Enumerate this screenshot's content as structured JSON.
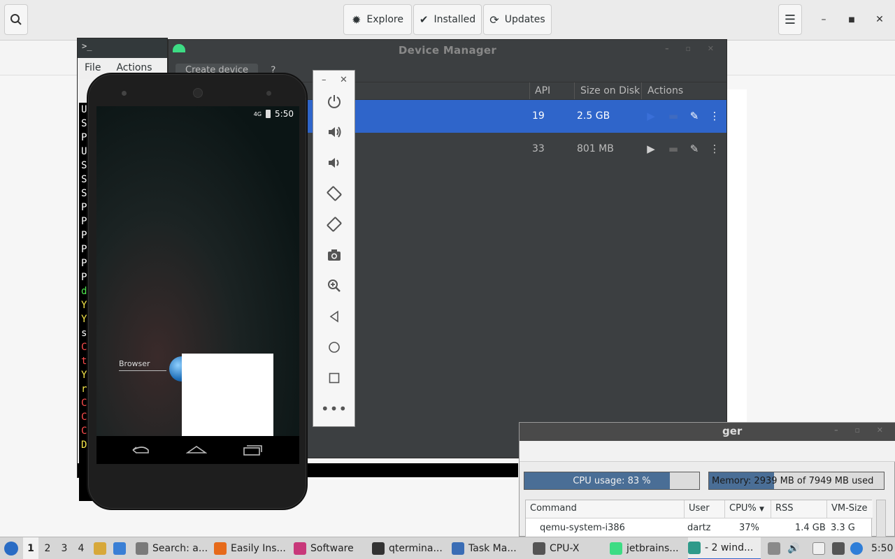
{
  "software": {
    "tabs": [
      {
        "label": "Explore",
        "icon": "compass-icon"
      },
      {
        "label": "Installed",
        "icon": "check-circle-icon"
      },
      {
        "label": "Updates",
        "icon": "refresh-icon"
      }
    ]
  },
  "qterminal": {
    "menu": [
      "File",
      "Actions"
    ],
    "lines": [
      {
        "t": "U",
        "c": "#ffffff"
      },
      {
        "t": "S",
        "c": "#ffffff"
      },
      {
        "t": "P",
        "c": "#ffffff"
      },
      {
        "t": "U",
        "c": "#ffffff"
      },
      {
        "t": "S",
        "c": "#ffffff"
      },
      {
        "t": "S",
        "c": "#ffffff"
      },
      {
        "t": "S",
        "c": "#ffffff"
      },
      {
        "t": "P",
        "c": "#ffffff"
      },
      {
        "t": "P",
        "c": "#ffffff"
      },
      {
        "t": "P",
        "c": "#ffffff"
      },
      {
        "t": "P",
        "c": "#ffffff"
      },
      {
        "t": "P",
        "c": "#ffffff"
      },
      {
        "t": "P",
        "c": "#ffffff"
      },
      {
        "t": "d",
        "c": "#4ee64e"
      },
      {
        "t": "Y",
        "c": "#f5e64a"
      },
      {
        "t": "Y",
        "c": "#f5e64a"
      },
      {
        "t": "s",
        "c": "#ffffff"
      },
      {
        "t": "C",
        "c": "#ff4d4d"
      },
      {
        "t": "t",
        "c": "#ff4d4d"
      },
      {
        "t": "Y",
        "c": "#f5e64a"
      },
      {
        "t": "r",
        "c": "#f5e64a"
      },
      {
        "t": "C",
        "c": "#ff4d4d"
      },
      {
        "t": "C",
        "c": "#ff4d4d"
      },
      {
        "t": "C",
        "c": "#ff4d4d"
      },
      {
        "t": "D",
        "c": "#f5e64a"
      }
    ]
  },
  "device_manager": {
    "title": "Device Manager",
    "create_label": "Create device",
    "help_label": "?",
    "columns": {
      "api": "API",
      "size": "Size on Disk",
      "actions": "Actions"
    },
    "rows": [
      {
        "api": "19",
        "size": "2.5 GB",
        "selected": true
      },
      {
        "api": "33",
        "size": "801 MB",
        "selected": false
      }
    ]
  },
  "emulator": {
    "clock": "5:50",
    "network": "4G",
    "app_label": "Browser",
    "panel_buttons": [
      "power-icon",
      "volume-up-icon",
      "volume-down-icon",
      "rotate-left-icon",
      "rotate-right-icon",
      "camera-icon",
      "zoom-icon",
      "back-icon",
      "home-icon",
      "overview-icon",
      "more-icon"
    ]
  },
  "task_manager": {
    "title_fragment": "ger",
    "cpu_label": "CPU usage: 83 %",
    "cpu_percent": 83,
    "mem_label": "Memory: 2939 MB of 7949 MB used",
    "mem_percent": 37,
    "columns": [
      "Command",
      "User",
      "CPU%",
      "RSS",
      "VM-Size"
    ],
    "process": {
      "command": "qemu-system-i386",
      "user": "dartz",
      "cpu": "37%",
      "rss": "1.4 GB",
      "vm": "3.3 G"
    }
  },
  "taskbar": {
    "workspaces": [
      "1",
      "2",
      "3",
      "4"
    ],
    "items": [
      {
        "label": "Search: a...",
        "color": "#7a7a7a"
      },
      {
        "label": "Easily Ins...",
        "color": "#e66a1a"
      },
      {
        "label": "Software",
        "color": "#c8387a"
      },
      {
        "label": "qtermina...",
        "color": "#333333"
      },
      {
        "label": "Task Ma...",
        "color": "#3a6db5"
      },
      {
        "label": "CPU-X",
        "color": "#555555"
      },
      {
        "label": "jetbrains...",
        "color": "#3ddc84"
      },
      {
        "label": "- 2 wind...",
        "color": "#2f9a8a"
      }
    ],
    "clock": "5:50"
  },
  "colors": {
    "accent": "#2f65ca",
    "dark_panel": "#3c3f41"
  }
}
